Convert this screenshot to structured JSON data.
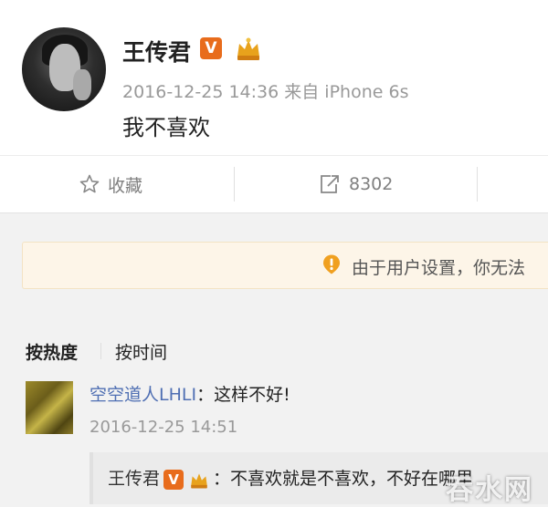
{
  "post": {
    "username": "王传君",
    "verified_badge": "V",
    "badge_icon": "crown-member-icon",
    "timestamp": "2016-12-25 14:36",
    "source": "来自 iPhone 6s",
    "content": "我不喜欢"
  },
  "actions": {
    "favorite_label": "收藏",
    "repost_count": "8302"
  },
  "notice": {
    "text": "由于用户设置，你无法"
  },
  "sort": {
    "by_hot": "按热度",
    "by_time": "按时间"
  },
  "comment": {
    "user": "空空道人LHLI",
    "text": "：这样不好!",
    "time": "2016-12-25 14:51"
  },
  "reply": {
    "user": "王传君",
    "badge": "V",
    "text": "：不喜欢就是不喜欢，不好在哪里"
  },
  "watermark": "吞水网",
  "colors": {
    "badge_orange": "#e86c1c",
    "link_blue": "#4f6fb3",
    "notice_bg": "#fdf5e8"
  }
}
